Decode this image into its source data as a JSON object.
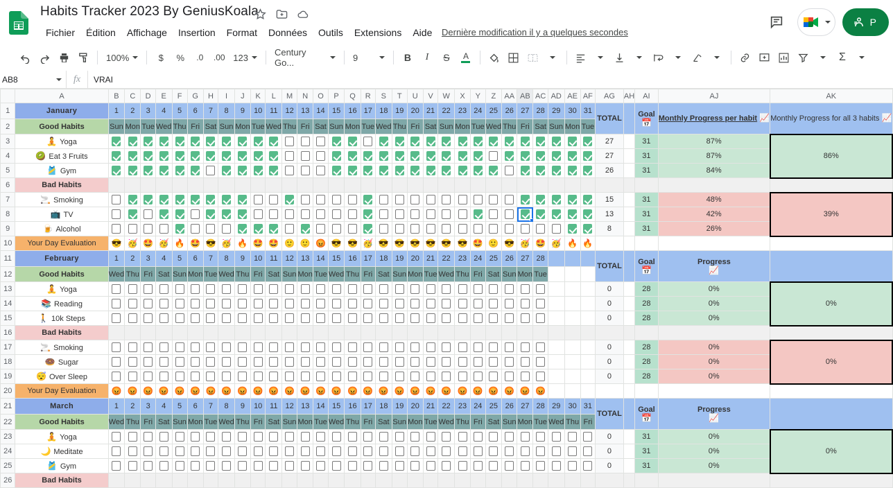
{
  "app": {
    "title": "Habits Tracker 2023 By GeniusKoala",
    "last_modified": "Dernière modification il y a quelques secondes",
    "share_label": "P",
    "menus": [
      "Fichier",
      "Édition",
      "Affichage",
      "Insertion",
      "Format",
      "Données",
      "Outils",
      "Extensions",
      "Aide"
    ]
  },
  "toolbar": {
    "zoom": "100%",
    "currency": "$",
    "percent": "%",
    "dec_less": ".0",
    "dec_more": ".00",
    "number_format": "123",
    "font": "Century Go...",
    "font_size": "9",
    "bold": "B",
    "italic": "I",
    "strike": "S",
    "text_color": "A"
  },
  "formula_bar": {
    "name_box": "AB8",
    "fx": "fx",
    "value": "VRAI"
  },
  "grid": {
    "col_headers": [
      "A",
      "B",
      "C",
      "D",
      "E",
      "F",
      "G",
      "H",
      "I",
      "J",
      "K",
      "L",
      "M",
      "N",
      "O",
      "P",
      "Q",
      "R",
      "S",
      "T",
      "U",
      "V",
      "W",
      "X",
      "Y",
      "Z",
      "AA",
      "AB",
      "AC",
      "AD",
      "AE",
      "AF",
      "AG",
      "AH",
      "AI",
      "AJ",
      "AK"
    ],
    "selected_col": "AB",
    "row_headers": [
      "1",
      "2",
      "3",
      "4",
      "5",
      "6",
      "7",
      "8",
      "9",
      "10",
      "11",
      "12",
      "13",
      "14",
      "15",
      "16",
      "17",
      "18",
      "19",
      "20",
      "21",
      "22",
      "23",
      "24",
      "25",
      "26"
    ]
  },
  "labels": {
    "good_habits": "Good Habits",
    "bad_habits": "Bad Habits",
    "day_evaluation": "Your Day Evaluation",
    "total": "TOTAL",
    "goal": "Goal",
    "monthly_progress_per_habit": "Monthly Progress per habit",
    "monthly_progress_all": "Monthly Progress for all 3 habits",
    "progress": "Progress"
  },
  "months": [
    {
      "name": "January",
      "days": [
        1,
        2,
        3,
        4,
        5,
        6,
        7,
        8,
        9,
        10,
        11,
        12,
        13,
        14,
        15,
        16,
        17,
        18,
        19,
        20,
        21,
        22,
        23,
        24,
        25,
        26,
        27,
        28,
        29,
        30,
        31
      ],
      "weekdays": [
        "Sun",
        "Mon",
        "Tue",
        "Wed",
        "Thu",
        "Fri",
        "Sat",
        "Sun",
        "Mon",
        "Tue",
        "Wed",
        "Thu",
        "Fri",
        "Sat",
        "Sun",
        "Mon",
        "Tue",
        "Wed",
        "Thu",
        "Fri",
        "Sat",
        "Sun",
        "Mon",
        "Tue",
        "Wed",
        "Thu",
        "Fri",
        "Sat",
        "Sun",
        "Mon",
        "Tue"
      ],
      "good": [
        {
          "emoji": "🧘",
          "name": "Yoga",
          "checks": [
            1,
            1,
            1,
            1,
            1,
            1,
            1,
            1,
            1,
            1,
            1,
            0,
            0,
            0,
            1,
            1,
            0,
            1,
            1,
            1,
            1,
            1,
            1,
            1,
            1,
            1,
            1,
            1,
            1,
            1,
            1
          ],
          "total": 27,
          "goal": 31,
          "progress": "87%"
        },
        {
          "emoji": "🥝",
          "name": "Eat 3 Fruits",
          "checks": [
            1,
            1,
            1,
            1,
            1,
            1,
            1,
            1,
            1,
            1,
            1,
            0,
            0,
            0,
            1,
            1,
            1,
            1,
            1,
            1,
            1,
            1,
            1,
            1,
            0,
            1,
            1,
            1,
            1,
            1,
            1
          ],
          "total": 27,
          "goal": 31,
          "progress": "87%"
        },
        {
          "emoji": "🎽",
          "name": "Gym",
          "checks": [
            1,
            1,
            1,
            1,
            1,
            1,
            0,
            1,
            1,
            1,
            1,
            0,
            0,
            0,
            1,
            1,
            1,
            1,
            1,
            1,
            1,
            1,
            1,
            1,
            1,
            0,
            1,
            1,
            1,
            1,
            1
          ],
          "total": 26,
          "goal": 31,
          "progress": "84%"
        }
      ],
      "good_agg": "86%",
      "bad": [
        {
          "emoji": "🚬",
          "name": "Smoking",
          "checks": [
            0,
            1,
            1,
            1,
            1,
            1,
            1,
            1,
            1,
            0,
            0,
            1,
            0,
            0,
            0,
            0,
            1,
            0,
            0,
            0,
            0,
            0,
            0,
            0,
            0,
            0,
            1,
            1,
            1,
            1,
            1
          ],
          "total": 15,
          "goal": 31,
          "progress": "48%"
        },
        {
          "emoji": "📺",
          "name": "TV",
          "checks": [
            0,
            1,
            0,
            1,
            1,
            0,
            1,
            1,
            1,
            0,
            0,
            0,
            0,
            0,
            0,
            0,
            1,
            0,
            0,
            0,
            0,
            0,
            0,
            1,
            0,
            0,
            1,
            1,
            1,
            1,
            1
          ],
          "total": 13,
          "goal": 31,
          "progress": "42%"
        },
        {
          "emoji": "🍺",
          "name": "Alcohol",
          "checks": [
            0,
            0,
            0,
            0,
            1,
            0,
            0,
            0,
            1,
            1,
            1,
            0,
            1,
            0,
            0,
            0,
            1,
            0,
            0,
            0,
            0,
            0,
            0,
            0,
            0,
            0,
            0,
            0,
            0,
            1,
            1
          ],
          "total": 8,
          "goal": 31,
          "progress": "26%"
        }
      ],
      "bad_agg": "39%",
      "evaluation": [
        "😎",
        "🥳",
        "🤩",
        "🥳",
        "🔥",
        "🤩",
        "😎",
        "🥳",
        "🔥",
        "🤩",
        "🤩",
        "🙂",
        "🙂",
        "😡",
        "😎",
        "😎",
        "🥳",
        "😎",
        "😎",
        "😎",
        "😎",
        "😎",
        "😎",
        "🤩",
        "🙂",
        "😎",
        "🥳",
        "🤩",
        "🥳",
        "🔥",
        "🔥"
      ],
      "headers": {
        "total": "TOTAL",
        "goal": "Goal",
        "per_habit": "Monthly Progress per habit",
        "all_habits": "Monthly Progress for all 3 habits"
      }
    },
    {
      "name": "February",
      "days": [
        1,
        2,
        3,
        4,
        5,
        6,
        7,
        8,
        9,
        10,
        11,
        12,
        13,
        14,
        15,
        16,
        17,
        18,
        19,
        20,
        21,
        22,
        23,
        24,
        25,
        26,
        27,
        28
      ],
      "weekdays": [
        "Wed",
        "Thu",
        "Fri",
        "Sat",
        "Sun",
        "Mon",
        "Tue",
        "Wed",
        "Thu",
        "Fri",
        "Sat",
        "Sun",
        "Mon",
        "Tue",
        "Wed",
        "Thu",
        "Fri",
        "Sat",
        "Sun",
        "Mon",
        "Tue",
        "Wed",
        "Thu",
        "Fri",
        "Sat",
        "Sun",
        "Mon",
        "Tue"
      ],
      "good": [
        {
          "emoji": "🧘",
          "name": "Yoga",
          "checks": [
            0,
            0,
            0,
            0,
            0,
            0,
            0,
            0,
            0,
            0,
            0,
            0,
            0,
            0,
            0,
            0,
            0,
            0,
            0,
            0,
            0,
            0,
            0,
            0,
            0,
            0,
            0,
            0
          ],
          "total": 0,
          "goal": 28,
          "progress": "0%"
        },
        {
          "emoji": "📚",
          "name": "Reading",
          "checks": [
            0,
            0,
            0,
            0,
            0,
            0,
            0,
            0,
            0,
            0,
            0,
            0,
            0,
            0,
            0,
            0,
            0,
            0,
            0,
            0,
            0,
            0,
            0,
            0,
            0,
            0,
            0,
            0
          ],
          "total": 0,
          "goal": 28,
          "progress": "0%"
        },
        {
          "emoji": "🚶",
          "name": "10k Steps",
          "checks": [
            0,
            0,
            0,
            0,
            0,
            0,
            0,
            0,
            0,
            0,
            0,
            0,
            0,
            0,
            0,
            0,
            0,
            0,
            0,
            0,
            0,
            0,
            0,
            0,
            0,
            0,
            0,
            0
          ],
          "total": 0,
          "goal": 28,
          "progress": "0%"
        }
      ],
      "good_agg": "0%",
      "bad": [
        {
          "emoji": "🚬",
          "name": "Smoking",
          "checks": [
            0,
            0,
            0,
            0,
            0,
            0,
            0,
            0,
            0,
            0,
            0,
            0,
            0,
            0,
            0,
            0,
            0,
            0,
            0,
            0,
            0,
            0,
            0,
            0,
            0,
            0,
            0,
            0
          ],
          "total": 0,
          "goal": 28,
          "progress": "0%"
        },
        {
          "emoji": "🍩",
          "name": "Sugar",
          "checks": [
            0,
            0,
            0,
            0,
            0,
            0,
            0,
            0,
            0,
            0,
            0,
            0,
            0,
            0,
            0,
            0,
            0,
            0,
            0,
            0,
            0,
            0,
            0,
            0,
            0,
            0,
            0,
            0
          ],
          "total": 0,
          "goal": 28,
          "progress": "0%"
        },
        {
          "emoji": "😴",
          "name": "Over Sleep",
          "checks": [
            0,
            0,
            0,
            0,
            0,
            0,
            0,
            0,
            0,
            0,
            0,
            0,
            0,
            0,
            0,
            0,
            0,
            0,
            0,
            0,
            0,
            0,
            0,
            0,
            0,
            0,
            0,
            0
          ],
          "total": 0,
          "goal": 28,
          "progress": "0%"
        }
      ],
      "bad_agg": "0%",
      "evaluation": [
        "😡",
        "😡",
        "😡",
        "😡",
        "😡",
        "😡",
        "😡",
        "😡",
        "😡",
        "😡",
        "😡",
        "😡",
        "😡",
        "😡",
        "😡",
        "😡",
        "😡",
        "😡",
        "😡",
        "😡",
        "😡",
        "😡",
        "😡",
        "😡",
        "😡",
        "😡",
        "😡",
        "😡"
      ],
      "headers": {
        "total": "TOTAL",
        "goal": "Goal",
        "per_habit": "Progress",
        "all_habits": ""
      }
    },
    {
      "name": "March",
      "days": [
        1,
        2,
        3,
        4,
        5,
        6,
        7,
        8,
        9,
        10,
        11,
        12,
        13,
        14,
        15,
        16,
        17,
        18,
        19,
        20,
        21,
        22,
        23,
        24,
        25,
        26,
        27,
        28,
        29,
        30,
        31
      ],
      "weekdays": [
        "Wed",
        "Thu",
        "Fri",
        "Sat",
        "Sun",
        "Mon",
        "Tue",
        "Wed",
        "Thu",
        "Fri",
        "Sat",
        "Sun",
        "Mon",
        "Tue",
        "Wed",
        "Thu",
        "Fri",
        "Sat",
        "Sun",
        "Mon",
        "Tue",
        "Wed",
        "Thu",
        "Fri",
        "Sat",
        "Sun",
        "Mon",
        "Tue",
        "Wed",
        "Thu",
        "Fri"
      ],
      "good": [
        {
          "emoji": "🧘",
          "name": "Yoga",
          "checks": [
            0,
            0,
            0,
            0,
            0,
            0,
            0,
            0,
            0,
            0,
            0,
            0,
            0,
            0,
            0,
            0,
            0,
            0,
            0,
            0,
            0,
            0,
            0,
            0,
            0,
            0,
            0,
            0,
            0,
            0,
            0
          ],
          "total": 0,
          "goal": 31,
          "progress": "0%"
        },
        {
          "emoji": "🌙",
          "name": "Meditate",
          "checks": [
            0,
            0,
            0,
            0,
            0,
            0,
            0,
            0,
            0,
            0,
            0,
            0,
            0,
            0,
            0,
            0,
            0,
            0,
            0,
            0,
            0,
            0,
            0,
            0,
            0,
            0,
            0,
            0,
            0,
            0,
            0
          ],
          "total": 0,
          "goal": 31,
          "progress": "0%"
        },
        {
          "emoji": "🎽",
          "name": "Gym",
          "checks": [
            0,
            0,
            0,
            0,
            0,
            0,
            0,
            0,
            0,
            0,
            0,
            0,
            0,
            0,
            0,
            0,
            0,
            0,
            0,
            0,
            0,
            0,
            0,
            0,
            0,
            0,
            0,
            0,
            0,
            0,
            0
          ],
          "total": 0,
          "goal": 31,
          "progress": "0%"
        }
      ],
      "good_agg": "0%",
      "bad": [],
      "bad_agg": "",
      "evaluation": [],
      "headers": {
        "total": "TOTAL",
        "goal": "Goal",
        "per_habit": "Progress",
        "all_habits": ""
      }
    }
  ],
  "colors": {
    "accent": "#0b8043",
    "month_header": "#8eadea",
    "good": "#b6d7a8",
    "bad": "#f4cccc",
    "eval": "#f6b26b",
    "checked": "#57bb8a"
  }
}
